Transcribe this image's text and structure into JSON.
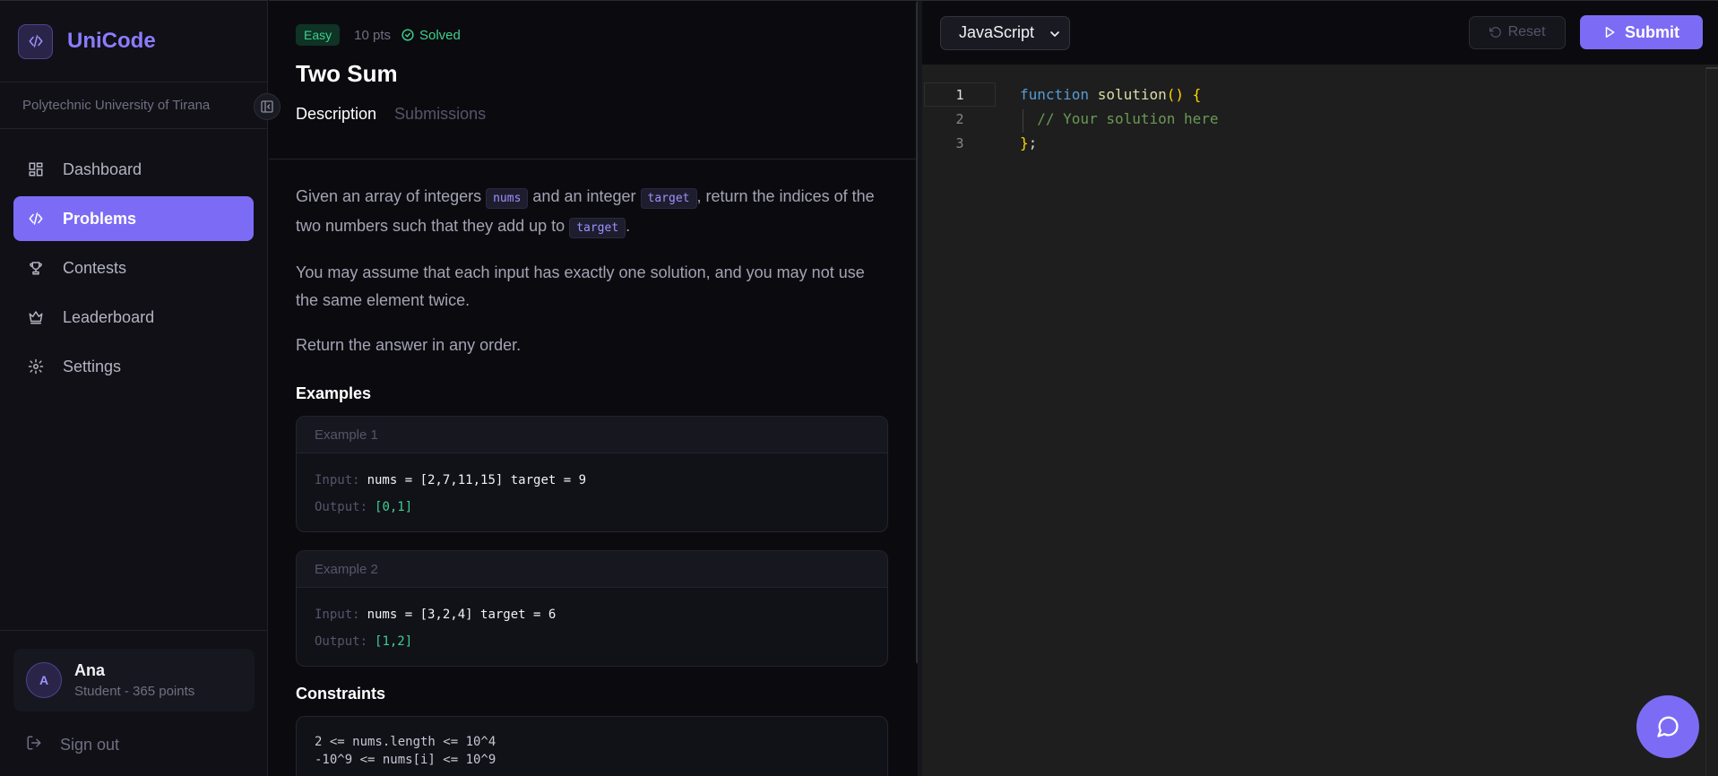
{
  "brand": {
    "name": "UniCode",
    "logo_icon": "code-icon"
  },
  "org": "Polytechnic University of Tirana",
  "nav": [
    {
      "label": "Dashboard",
      "icon": "grid-icon",
      "active": false
    },
    {
      "label": "Problems",
      "icon": "code-icon",
      "active": true
    },
    {
      "label": "Contests",
      "icon": "trophy-icon",
      "active": false
    },
    {
      "label": "Leaderboard",
      "icon": "crown-icon",
      "active": false
    },
    {
      "label": "Settings",
      "icon": "gear-icon",
      "active": false
    }
  ],
  "user": {
    "initial": "A",
    "name": "Ana",
    "meta": "Student - 365 points"
  },
  "signout": "Sign out",
  "problem": {
    "difficulty": "Easy",
    "points": "10 pts",
    "status": "Solved",
    "title": "Two Sum",
    "tabs": [
      "Description",
      "Submissions"
    ],
    "desc1_a": "Given an array of integers ",
    "desc1_code1": "nums",
    "desc1_b": " and an integer ",
    "desc1_code2": "target",
    "desc1_c": ", return the indices of the two numbers such that they add up to ",
    "desc1_code3": "target",
    "desc1_d": ".",
    "desc2": "You may assume that each input has exactly one solution, and you may not use the same element twice.",
    "desc3": "Return the answer in any order.",
    "examples_title": "Examples",
    "examples": [
      {
        "title": "Example 1",
        "input_label": "Input:",
        "input": "nums = [2,7,11,15] target = 9",
        "output_label": "Output:",
        "output": "[0,1]"
      },
      {
        "title": "Example 2",
        "input_label": "Input:",
        "input": "nums = [3,2,4] target = 6",
        "output_label": "Output:",
        "output": "[1,2]"
      }
    ],
    "constraints_title": "Constraints",
    "constraints": [
      "2 <= nums.length <= 10^4",
      "-10^9 <= nums[i] <= 10^9"
    ]
  },
  "editor": {
    "language": "JavaScript",
    "reset_label": "Reset",
    "submit_label": "Submit",
    "line_numbers": [
      "1",
      "2",
      "3"
    ],
    "code": {
      "kw": "function",
      "fn": "solution",
      "parens": "()",
      "brace_open": "{",
      "comment": "// Your solution here",
      "brace_close": "}",
      "semi": ";"
    }
  },
  "colors": {
    "accent": "#7c6cf5",
    "success": "#3ecf8e",
    "background": "#0b0b0f",
    "editor_bg": "#1e1e1e"
  }
}
